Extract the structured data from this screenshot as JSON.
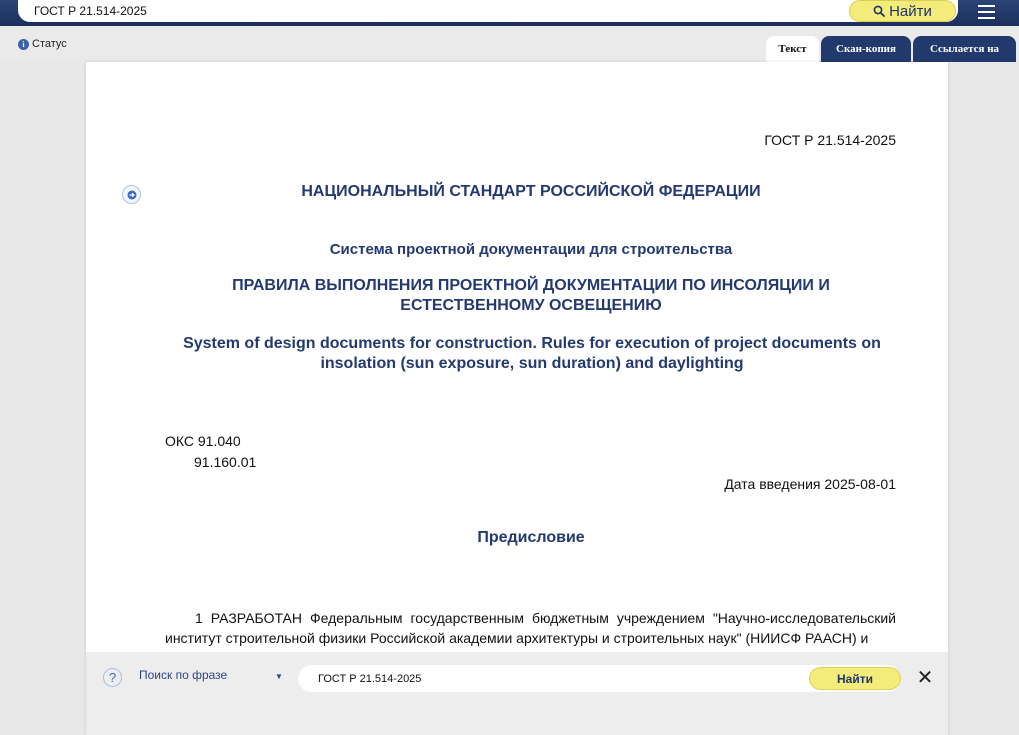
{
  "top_search": {
    "value": "ГОСТ Р 21.514-2025",
    "find_label": "Найти"
  },
  "status": {
    "label": "Статус"
  },
  "tabs": [
    {
      "label": "Текст",
      "active": true
    },
    {
      "label": "Скан-копия",
      "active": false
    },
    {
      "label": "Ссылается на",
      "active": false
    }
  ],
  "document": {
    "number": "ГОСТ Р 21.514-2025",
    "title": "НАЦИОНАЛЬНЫЙ СТАНДАРТ РОССИЙСКОЙ ФЕДЕРАЦИИ",
    "system": "Система проектной документации для строительства",
    "name_ru": "ПРАВИЛА ВЫПОЛНЕНИЯ ПРОЕКТНОЙ ДОКУМЕНТАЦИИ ПО ИНСОЛЯЦИИ И ЕСТЕСТВЕННОМУ ОСВЕЩЕНИЮ",
    "name_en": "System of design documents for construction. Rules for execution of project documents on insolation (sun exposure, sun duration) and daylighting",
    "oks_1": "ОКС 91.040",
    "oks_2": "91.160.01",
    "intro_date": "Дата введения 2025-08-01",
    "preface_title": "Предисловие",
    "preface_text": "1 РАЗРАБОТАН Федеральным государственным бюджетным учреждением \"Научно-исследовательский институт строительной физики Российской академии архитектуры и строительных наук\" (НИИСФ РААСН) и"
  },
  "find_panel": {
    "mode_label": "Поиск по фразе",
    "query": "ГОСТ Р 21.514-2025",
    "find_label": "Найти"
  },
  "colors": {
    "navy": "#1c2f5c",
    "heading_blue": "#23396f",
    "button_yellow": "#f3eb7a"
  },
  "icons": [
    "search-icon",
    "menu-icon",
    "info-icon",
    "arrow-right-icon",
    "help-icon",
    "close-icon"
  ]
}
